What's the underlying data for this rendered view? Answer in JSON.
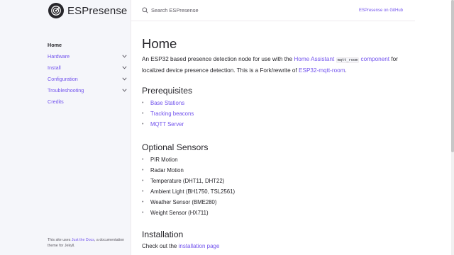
{
  "site": {
    "title": "ESPresense"
  },
  "search": {
    "placeholder": "Search ESPresense"
  },
  "header": {
    "aux_link": "ESPresense on GitHub"
  },
  "sidebar": {
    "items": [
      {
        "label": "Home",
        "active": true,
        "expandable": false
      },
      {
        "label": "Hardware",
        "active": false,
        "expandable": true
      },
      {
        "label": "Install",
        "active": false,
        "expandable": true
      },
      {
        "label": "Configuration",
        "active": false,
        "expandable": true
      },
      {
        "label": "Troubleshooting",
        "active": false,
        "expandable": true
      },
      {
        "label": "Credits",
        "active": false,
        "expandable": false
      }
    ],
    "footer": {
      "prefix": "This site uses ",
      "link": "Just the Docs",
      "suffix": ", a documentation theme for Jekyll."
    }
  },
  "main": {
    "title": "Home",
    "intro": {
      "part1": "An ESP32 based presence detection node for use with the ",
      "link1": "Home Assistant",
      "code": "mqtt_room",
      "link2": "component",
      "part2": " for localized device presence detection. This is a Fork/rewrite of ",
      "link3": "ESP32-mqtt-room",
      "part3": "."
    },
    "prerequisites": {
      "heading": "Prerequisites",
      "items": [
        "Base Stations",
        "Tracking beacons",
        "MQTT Server"
      ]
    },
    "optional_sensors": {
      "heading": "Optional Sensors",
      "items": [
        "PIR Motion",
        "Radar Motion",
        "Temperature (DHT11, DHT22)",
        "Ambient Light (BH1750, TSL2561)",
        "Weather Sensor (BME280)",
        "Weight Sensor (HX711)"
      ]
    },
    "installation": {
      "heading": "Installation",
      "text": "Check out the ",
      "link": "installation page"
    }
  },
  "colors": {
    "link": "#7253ed",
    "text": "#27262b",
    "sidebar_bg": "#f5f6fa"
  },
  "icons": {
    "logo": "espresense-logo-icon",
    "search": "search-icon",
    "expand": "chevron-down-icon"
  }
}
